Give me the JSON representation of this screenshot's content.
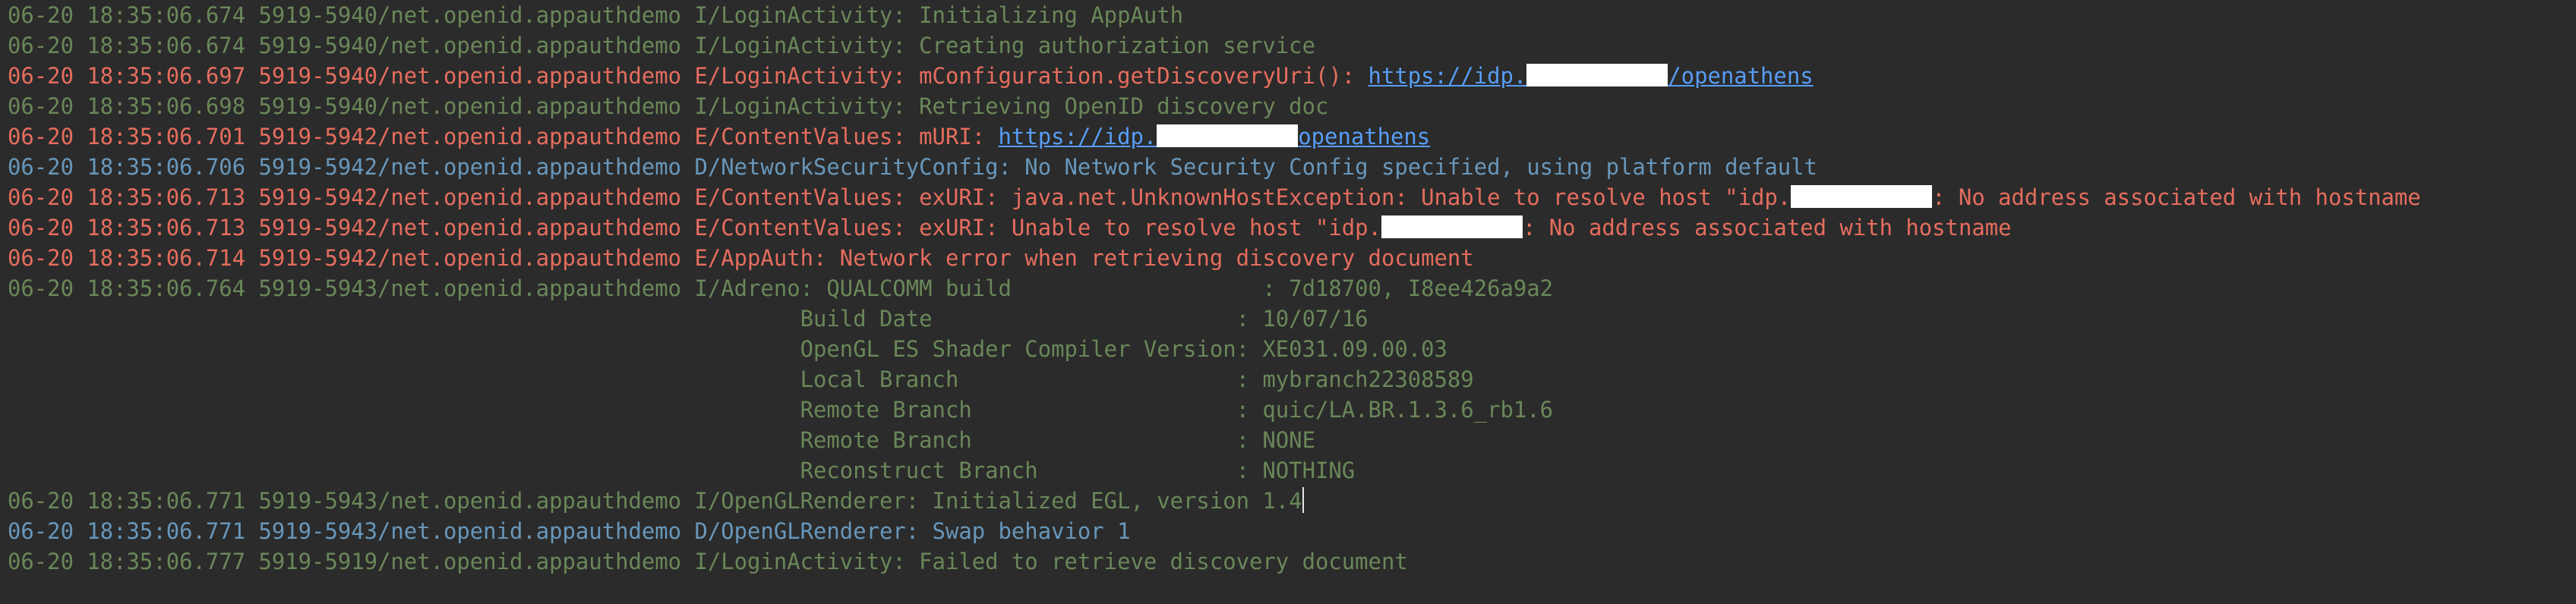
{
  "log": {
    "lines": [
      {
        "level": "I",
        "text": "06-20 18:35:06.674 5919-5940/net.openid.appauthdemo I/LoginActivity: Initializing AppAuth"
      },
      {
        "level": "I",
        "text": "06-20 18:35:06.674 5919-5940/net.openid.appauthdemo I/LoginActivity: Creating authorization service"
      },
      {
        "level": "E",
        "prefix": "06-20 18:35:06.697 5919-5940/net.openid.appauthdemo E/LoginActivity: mConfiguration.getDiscoveryUri(): ",
        "link_start": "https://idp.",
        "link_end": "/openathens"
      },
      {
        "level": "I",
        "text": "06-20 18:35:06.698 5919-5940/net.openid.appauthdemo I/LoginActivity: Retrieving OpenID discovery doc"
      },
      {
        "level": "E",
        "prefix": "06-20 18:35:06.701 5919-5942/net.openid.appauthdemo E/ContentValues: mURI: ",
        "link_start": "https://idp.",
        "link_end": "openathens"
      },
      {
        "level": "D",
        "text": "06-20 18:35:06.706 5919-5942/net.openid.appauthdemo D/NetworkSecurityConfig: No Network Security Config specified, using platform default"
      },
      {
        "level": "E",
        "before": "06-20 18:35:06.713 5919-5942/net.openid.appauthdemo E/ContentValues: exURI: java.net.UnknownHostException: Unable to resolve host \"idp.",
        "after": ": No address associated with hostname"
      },
      {
        "level": "E",
        "before": "06-20 18:35:06.713 5919-5942/net.openid.appauthdemo E/ContentValues: exURI: Unable to resolve host \"idp.",
        "after": ": No address associated with hostname"
      },
      {
        "level": "E",
        "text": "06-20 18:35:06.714 5919-5942/net.openid.appauthdemo E/AppAuth: Network error when retrieving discovery document"
      },
      {
        "level": "I",
        "text": "06-20 18:35:06.764 5919-5943/net.openid.appauthdemo I/Adreno: QUALCOMM build                   : 7d18700, I8ee426a9a2"
      },
      {
        "level": "I",
        "text": "                                                            Build Date                       : 10/07/16"
      },
      {
        "level": "I",
        "text": "                                                            OpenGL ES Shader Compiler Version: XE031.09.00.03"
      },
      {
        "level": "I",
        "text": "                                                            Local Branch                     : mybranch22308589"
      },
      {
        "level": "I",
        "text": "                                                            Remote Branch                    : quic/LA.BR.1.3.6_rb1.6"
      },
      {
        "level": "I",
        "text": "                                                            Remote Branch                    : NONE"
      },
      {
        "level": "I",
        "text": "                                                            Reconstruct Branch               : NOTHING"
      },
      {
        "level": "I",
        "text": "06-20 18:35:06.771 5919-5943/net.openid.appauthdemo I/OpenGLRenderer: Initialized EGL, version 1.4"
      },
      {
        "level": "D",
        "text": "06-20 18:35:06.771 5919-5943/net.openid.appauthdemo D/OpenGLRenderer: Swap behavior 1"
      },
      {
        "level": "I",
        "text": "06-20 18:35:06.777 5919-5919/net.openid.appauthdemo I/LoginActivity: Failed to retrieve discovery document"
      }
    ]
  },
  "colors": {
    "background": "#2b2b2b",
    "info": "#6a8759",
    "error": "#e66d5e",
    "debug": "#6897bb",
    "link": "#589df6",
    "redaction": "#ffffff"
  }
}
